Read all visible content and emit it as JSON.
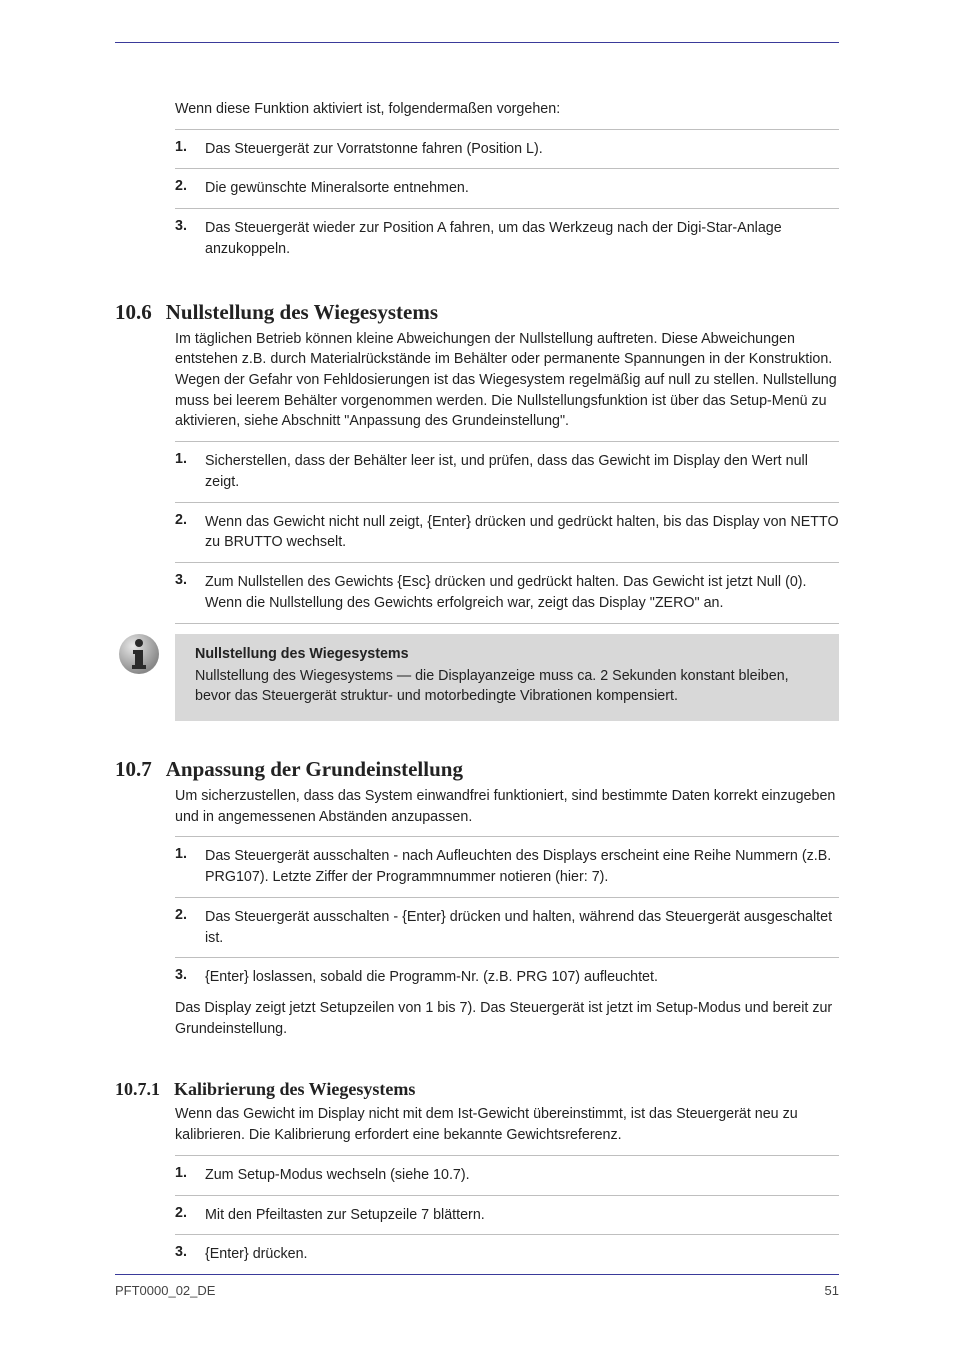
{
  "topPara": "Wenn diese Funktion aktiviert ist, folgendermaßen vorgehen:",
  "initialSteps": [
    "Das Steuergerät zur Vorratstonne fahren (Position L).",
    "Die gewünschte Mineralsorte entnehmen.",
    "Das Steuergerät wieder zur Position A fahren, um das Werkzeug nach der Digi-Star-Anlage anzukoppeln."
  ],
  "section1": {
    "number": "10.6",
    "title": "Nullstellung des Wiegesystems",
    "text": "Im täglichen Betrieb können kleine Abweichungen der Nullstellung auftreten. Diese Abweichungen entstehen z.B. durch Materialrückstände im Behälter oder permanente Spannungen in der Konstruktion. Wegen der Gefahr von Fehldosierungen ist das Wiegesystem regelmäßig auf null zu stellen. Nullstellung muss bei leerem Behälter vorgenommen werden. Die Nullstellungsfunktion ist über das Setup-Menü zu aktivieren, siehe Abschnitt \"Anpassung des Grundeinstellung\".",
    "steps": [
      "Sicherstellen, dass der Behälter leer ist, und prüfen, dass das Gewicht im Display den Wert null zeigt.",
      "Wenn das Gewicht nicht null zeigt, {Enter} drücken und gedrückt halten, bis das Display von NETTO zu BRUTTO wechselt.",
      "Zum Nullstellen des Gewichts {Esc} drücken und gedrückt halten. Das Gewicht ist jetzt Null (0). Wenn die Nullstellung des Gewichts erfolgreich war, zeigt das Display \"ZERO\" an."
    ]
  },
  "note": {
    "heading": "Nullstellung des Wiegesystems",
    "text": "Nullstellung des Wiegesystems — die Displayanzeige muss ca. 2 Sekunden konstant bleiben, bevor das Steuergerät struktur- und motorbedingte Vibrationen kompensiert."
  },
  "section2": {
    "number": "10.7",
    "title": "Anpassung der Grundeinstellung",
    "intro": "Um sicherzustellen, dass das System einwandfrei funktioniert, sind bestimmte Daten korrekt einzugeben und in angemessenen Abständen anzupassen.",
    "steps": [
      "Das Steuergerät ausschalten - nach Aufleuchten des Displays erscheint eine Reihe Nummern (z.B. PRG107). Letzte Ziffer der Programmnummer notieren (hier: 7).",
      "Das Steuergerät ausschalten - {Enter} drücken und halten, während das Steuergerät ausgeschaltet ist.",
      "{Enter} loslassen, sobald die Programm-Nr. (z.B. PRG 107) aufleuchtet."
    ],
    "postText": "Das Display zeigt jetzt Setupzeilen von 1 bis 7). Das Steuergerät ist jetzt im Setup-Modus und bereit zur Grundeinstellung."
  },
  "section3": {
    "number": "10.7.1",
    "title": "Kalibrierung des Wiegesystems",
    "text": "Wenn das Gewicht im Display nicht mit dem Ist-Gewicht übereinstimmt, ist das Steuergerät neu zu kalibrieren. Die Kalibrierung erfordert eine bekannte Gewichtsreferenz.",
    "steps": [
      "Zum Setup-Modus wechseln (siehe 10.7).",
      "Mit den Pfeiltasten zur Setupzeile 7 blättern.",
      "{Enter} drücken."
    ]
  },
  "footer": {
    "left": "PFT0000_02_DE",
    "right": "51"
  }
}
